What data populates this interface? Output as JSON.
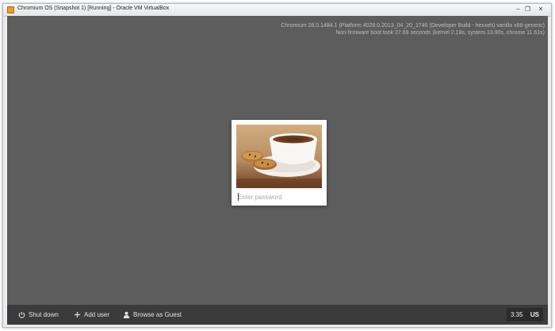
{
  "window": {
    "title": "Chromium OS  (Snapshot 1) [Running] - Oracle VM VirtualBox",
    "minimize_glyph": "–",
    "restore_glyph": "❐",
    "close_glyph": "✕"
  },
  "version_info": {
    "line1": "Chromium 28.0.1484.1 (Platform 4028.0.2013_04_20_1746 (Developer Build - hexxeh) vanilla x86-generic)",
    "line2": "Non-firmware boot took 27.69 seconds (kernel 2.18s, system 13.90s, chrome 11.61s)"
  },
  "login": {
    "user_image": "coffee-cup-with-cookies",
    "password_placeholder": "Enter password"
  },
  "shelf": {
    "shutdown_label": "Shut down",
    "add_user_label": "Add user",
    "guest_label": "Browse as Guest"
  },
  "status": {
    "time": "3:35",
    "keyboard_layout": "US"
  },
  "colors": {
    "desktop_bg": "#5c5d5c",
    "shelf_bg": "#3b3b3b"
  }
}
